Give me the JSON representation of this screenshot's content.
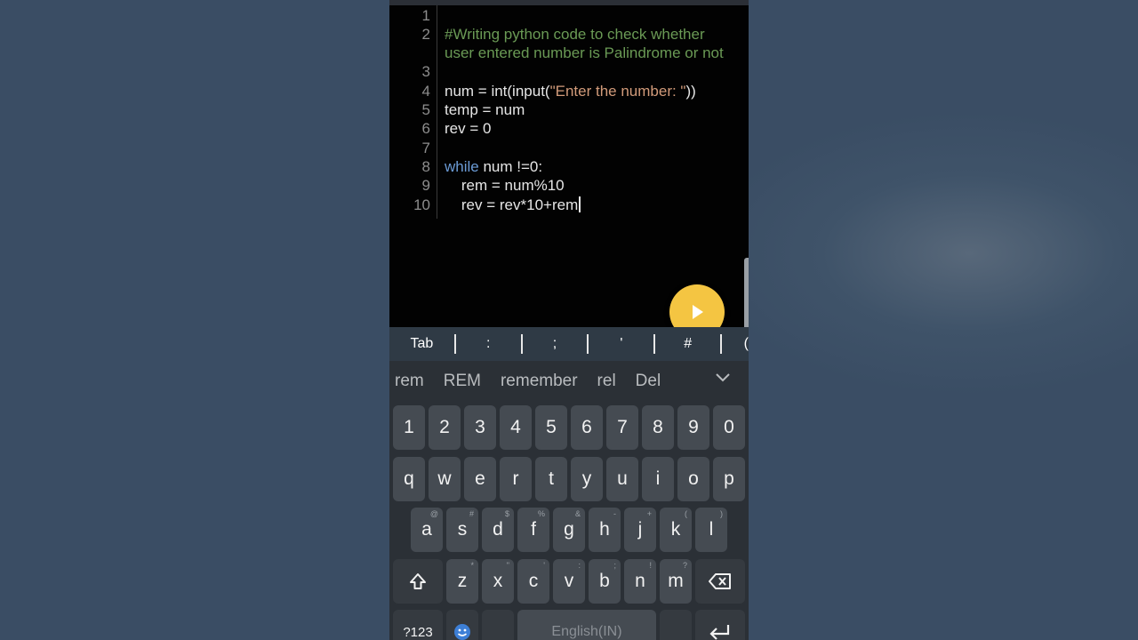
{
  "editor": {
    "lines": [
      {
        "n": "1",
        "text": ""
      },
      {
        "n": "2",
        "text": "#Writing python code to check whether"
      },
      {
        "n": "",
        "text": "user entered number is Palindrome or not"
      },
      {
        "n": "3",
        "text": ""
      },
      {
        "n": "4",
        "pre": "num = int(input(",
        "str": "\"Enter the number: \"",
        "post": "))"
      },
      {
        "n": "5",
        "text": "temp = num"
      },
      {
        "n": "6",
        "text": "rev = 0"
      },
      {
        "n": "7",
        "text": ""
      },
      {
        "n": "8",
        "kw": "while",
        "post": " num !=0:"
      },
      {
        "n": "9",
        "text": "    rem = num%10"
      },
      {
        "n": "10",
        "text": "    rev = rev*10+rem"
      }
    ]
  },
  "run_button": {
    "icon": "play-icon",
    "color": "#f4c542"
  },
  "symbol_bar": [
    "Tab",
    ":",
    ";",
    "'",
    "#",
    "("
  ],
  "suggestions": [
    "rem",
    "REM",
    "remember",
    "rel",
    "Del"
  ],
  "keyboard": {
    "row_numbers": [
      "1",
      "2",
      "3",
      "4",
      "5",
      "6",
      "7",
      "8",
      "9",
      "0"
    ],
    "row_q": [
      "q",
      "w",
      "e",
      "r",
      "t",
      "y",
      "u",
      "i",
      "o",
      "p"
    ],
    "row_a": [
      "a",
      "s",
      "d",
      "f",
      "g",
      "h",
      "j",
      "k",
      "l"
    ],
    "row_a_hints": [
      "@",
      "#",
      "$",
      "%",
      "&",
      "-",
      "+",
      "(",
      ")"
    ],
    "row_z": [
      "z",
      "x",
      "c",
      "v",
      "b",
      "n",
      "m"
    ],
    "row_z_hints": [
      "*",
      "\"",
      "'",
      ":",
      ";",
      "!",
      "?"
    ],
    "mode_key": "?123",
    "space_label": "English(IN)"
  }
}
